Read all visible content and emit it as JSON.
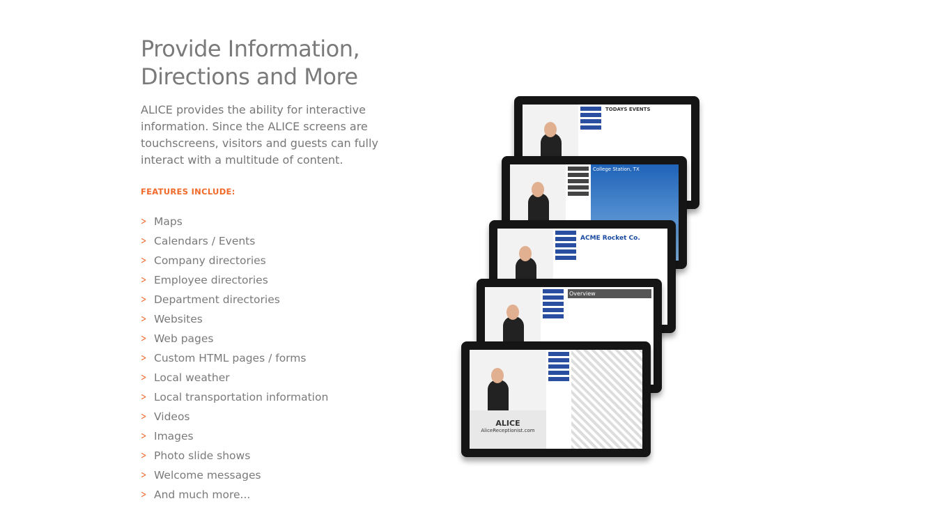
{
  "heading": {
    "line1": "Provide Information,",
    "line2": "Directions and More"
  },
  "intro": "ALICE provides the ability for interactive information. Since the ALICE screens are touchscreens, visitors and guests can fully interact with a multitude of content.",
  "features_label": "FEATURES INCLUDE:",
  "features": [
    "Maps",
    "Calendars / Events",
    "Company directories",
    "Employee directories",
    "Department directories",
    "Websites",
    "Web pages",
    "Custom HTML pages / forms",
    "Local weather",
    "Local transportation information",
    "Videos",
    "Images",
    "Photo slide shows",
    "Welcome messages",
    "And much more..."
  ],
  "colors": {
    "accent": "#f26a2a",
    "text": "#777777"
  },
  "image": {
    "screen1": "TODAYS EVENTS",
    "screen2": "College Station, TX",
    "screen3": "ACME Rocket Co.",
    "screen4": "Overview",
    "logo": "ALICE",
    "logo_url": "AliceReceptionist.com"
  }
}
